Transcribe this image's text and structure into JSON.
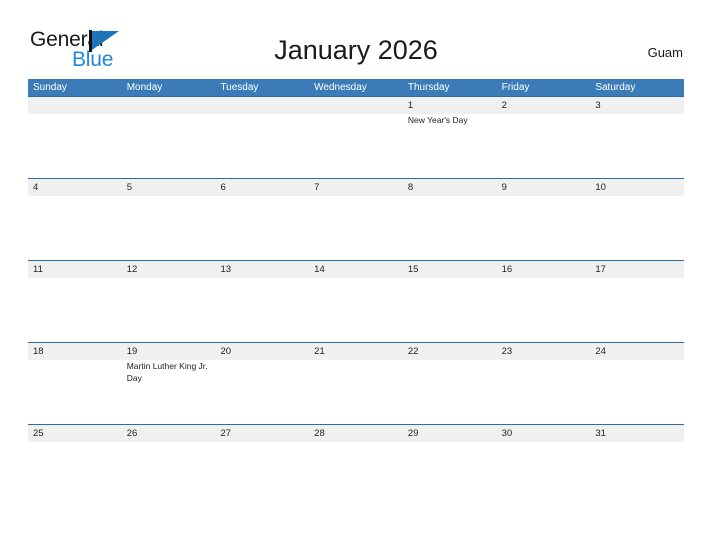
{
  "brand": {
    "name_part1": "General",
    "name_part2": "Blue",
    "flag_icon": "blue-flag-icon"
  },
  "header": {
    "title": "January 2026",
    "location": "Guam"
  },
  "colors": {
    "header_blue": "#3b7cb8",
    "row_rule_blue": "#2e6da4",
    "date_band_gray": "#f0f0f0",
    "brand_blue": "#1f87e0",
    "text": "#222222"
  },
  "weekdays": [
    "Sunday",
    "Monday",
    "Tuesday",
    "Wednesday",
    "Thursday",
    "Friday",
    "Saturday"
  ],
  "weeks": [
    {
      "days": [
        {
          "date": "",
          "event": ""
        },
        {
          "date": "",
          "event": ""
        },
        {
          "date": "",
          "event": ""
        },
        {
          "date": "",
          "event": ""
        },
        {
          "date": "1",
          "event": "New Year's Day"
        },
        {
          "date": "2",
          "event": ""
        },
        {
          "date": "3",
          "event": ""
        }
      ]
    },
    {
      "days": [
        {
          "date": "4",
          "event": ""
        },
        {
          "date": "5",
          "event": ""
        },
        {
          "date": "6",
          "event": ""
        },
        {
          "date": "7",
          "event": ""
        },
        {
          "date": "8",
          "event": ""
        },
        {
          "date": "9",
          "event": ""
        },
        {
          "date": "10",
          "event": ""
        }
      ]
    },
    {
      "days": [
        {
          "date": "11",
          "event": ""
        },
        {
          "date": "12",
          "event": ""
        },
        {
          "date": "13",
          "event": ""
        },
        {
          "date": "14",
          "event": ""
        },
        {
          "date": "15",
          "event": ""
        },
        {
          "date": "16",
          "event": ""
        },
        {
          "date": "17",
          "event": ""
        }
      ]
    },
    {
      "days": [
        {
          "date": "18",
          "event": ""
        },
        {
          "date": "19",
          "event": "Martin Luther King Jr. Day"
        },
        {
          "date": "20",
          "event": ""
        },
        {
          "date": "21",
          "event": ""
        },
        {
          "date": "22",
          "event": ""
        },
        {
          "date": "23",
          "event": ""
        },
        {
          "date": "24",
          "event": ""
        }
      ]
    },
    {
      "days": [
        {
          "date": "25",
          "event": ""
        },
        {
          "date": "26",
          "event": ""
        },
        {
          "date": "27",
          "event": ""
        },
        {
          "date": "28",
          "event": ""
        },
        {
          "date": "29",
          "event": ""
        },
        {
          "date": "30",
          "event": ""
        },
        {
          "date": "31",
          "event": ""
        }
      ]
    }
  ]
}
